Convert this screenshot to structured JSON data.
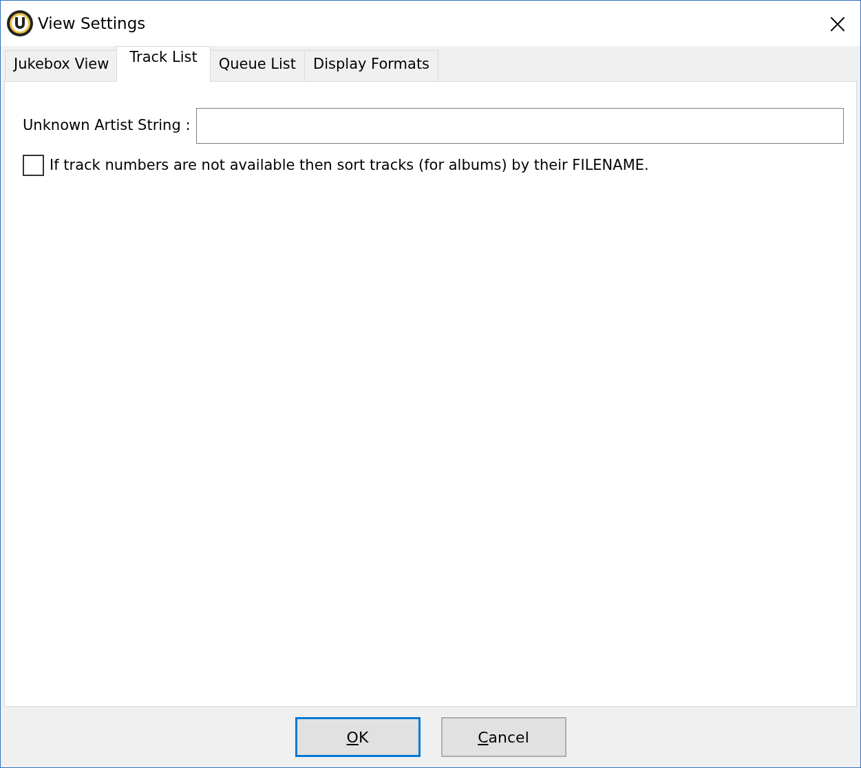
{
  "window": {
    "title": "View Settings",
    "close": "×"
  },
  "tabs": [
    {
      "label": "Jukebox View",
      "selected": false
    },
    {
      "label": "Track List",
      "selected": true
    },
    {
      "label": "Queue List",
      "selected": false
    },
    {
      "label": "Display Formats",
      "selected": false
    }
  ],
  "unknown_artist": {
    "label": "Unknown Artist String :"
  },
  "sort_option": {
    "label": "If track numbers are not available then sort tracks (for albums) by their FILENAME.",
    "checked": false
  },
  "buttons": [
    {
      "label": "OK",
      "first_letter_underlined": true,
      "default": true
    },
    {
      "label": "Cancel",
      "first_letter_underlined": true,
      "default": false
    }
  ]
}
